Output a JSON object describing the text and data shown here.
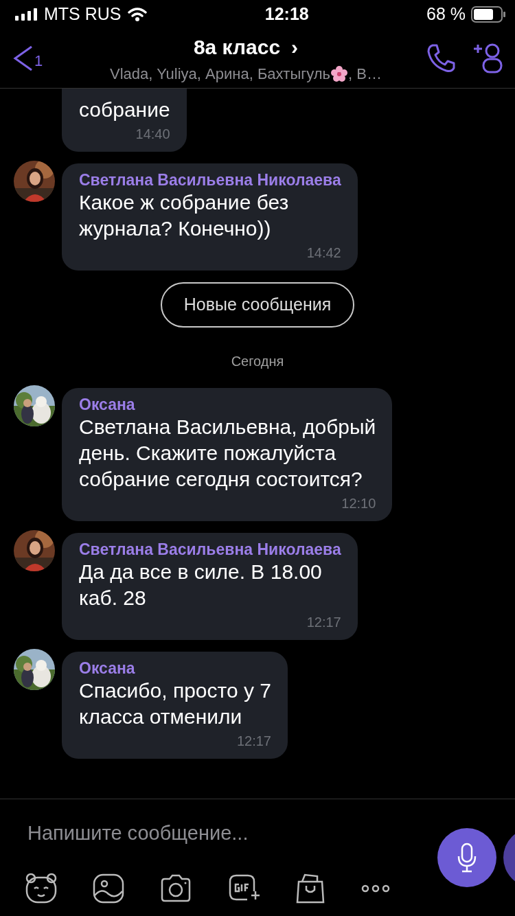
{
  "status_bar": {
    "carrier": "MTS RUS",
    "time": "12:18",
    "battery": "68 %"
  },
  "header": {
    "back_count": "1",
    "title": "8а класс",
    "title_arrow": "›",
    "subtitle_parts": [
      "Vlada, Yuliya, Арина, Бахтыгуль",
      ", В…"
    ]
  },
  "messages": [
    {
      "kind": "incoming",
      "text": "собрание",
      "time": "14:40"
    },
    {
      "kind": "incoming",
      "sender": "Светлана Васильевна Николаева",
      "text": "Какое ж собрание без\nжурнала? Конечно))",
      "time": "14:42"
    },
    {
      "kind": "new_marker",
      "label": "Новые сообщения"
    },
    {
      "kind": "date",
      "label": "Сегодня"
    },
    {
      "kind": "incoming",
      "sender": "Оксана",
      "text": "Светлана Васильевна, добрый\nдень. Скажите пожалуйста\nсобрание сегодня состоится?",
      "time": "12:10"
    },
    {
      "kind": "incoming",
      "sender": "Светлана Васильевна Николаева",
      "text": "Да да все в силе. В 18.00\nкаб. 28",
      "time": "12:17"
    },
    {
      "kind": "incoming",
      "sender": "Оксана",
      "text": "Спасибо, просто у 7\nкласса отменили",
      "time": "12:17"
    }
  ],
  "composer": {
    "placeholder": "Напишите сообщение..."
  }
}
